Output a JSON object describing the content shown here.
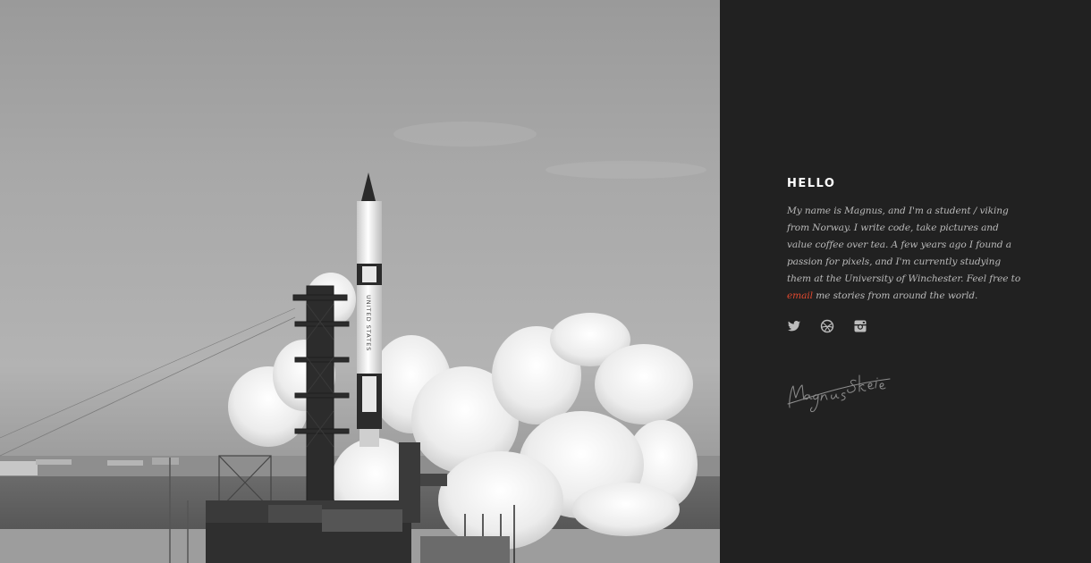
{
  "hero_image": {
    "rocket_text": "UNITED STATES"
  },
  "about": {
    "heading": "HELLO",
    "bio_before_link": "My name is Magnus, and I'm a student / viking from Norway. I write code, take pictures and value coffee over tea. A few years ago I found a passion for pixels, and I'm currently studying them at the University of Winchester. Feel free to ",
    "email_link_label": "email",
    "bio_after_link": " me stories from around the world.",
    "link_color": "#e2492f"
  },
  "social": [
    {
      "name": "twitter",
      "icon": "twitter-icon"
    },
    {
      "name": "dribbble",
      "icon": "dribbble-icon"
    },
    {
      "name": "instagram",
      "icon": "instagram-icon"
    }
  ],
  "signature": {
    "text": "Magnus Skeie"
  }
}
